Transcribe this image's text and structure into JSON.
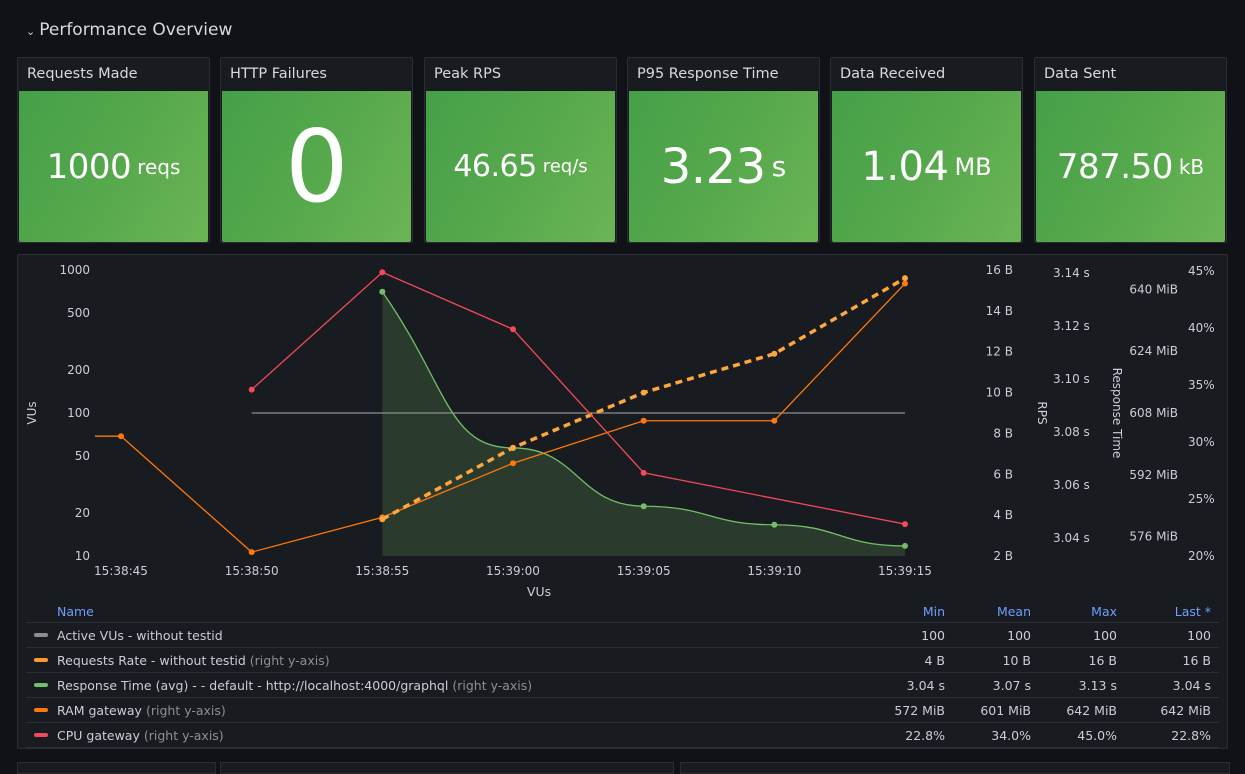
{
  "row": {
    "title": "Performance Overview",
    "collapse_icon": "chevron-down-icon"
  },
  "stats": [
    {
      "title": "Requests Made",
      "value": "1000",
      "unit": "reqs"
    },
    {
      "title": "HTTP Failures",
      "value": "0",
      "unit": ""
    },
    {
      "title": "Peak RPS",
      "value": "46.65",
      "unit": "req/s"
    },
    {
      "title": "P95 Response Time",
      "value": "3.23",
      "unit": "s"
    },
    {
      "title": "Data Received",
      "value": "1.04",
      "unit": "MB"
    },
    {
      "title": "Data Sent",
      "value": "787.50",
      "unit": "kB"
    }
  ],
  "colors": {
    "stat_green": "#56a84c",
    "vus": "#8e8e8e",
    "rps": "#ff9830",
    "resp": "#73bf69",
    "ram": "#ff780a",
    "cpu": "#f2495c"
  },
  "chart_data": {
    "type": "line",
    "title": "",
    "xlabel": "VUs",
    "x": [
      "15:38:45",
      "15:38:50",
      "15:38:55",
      "15:39:00",
      "15:39:05",
      "15:39:10",
      "15:39:15"
    ],
    "axes": {
      "left": {
        "label": "VUs",
        "scale": "log",
        "range": [
          10,
          1000
        ],
        "ticks": [
          "1000",
          "500",
          "200",
          "100",
          "50",
          "20",
          "10"
        ],
        "tick_values": [
          1000,
          500,
          200,
          100,
          50,
          20,
          10
        ]
      },
      "rps": {
        "label": "RPS",
        "range": [
          2,
          16
        ],
        "ticks": [
          "16 B",
          "14 B",
          "12 B",
          "10 B",
          "8 B",
          "6 B",
          "4 B",
          "2 B"
        ],
        "tick_values": [
          16,
          14,
          12,
          10,
          8,
          6,
          4,
          2
        ]
      },
      "resp": {
        "label": "Response Time",
        "range": [
          3.0332,
          3.1412
        ],
        "ticks": [
          "3.14 s",
          "3.12 s",
          "3.10 s",
          "3.08 s",
          "3.06 s",
          "3.04 s"
        ],
        "tick_values": [
          3.14,
          3.12,
          3.1,
          3.08,
          3.06,
          3.04
        ]
      },
      "ram": {
        "label": "",
        "range": [
          571,
          645
        ],
        "ticks": [
          "640 MiB",
          "624 MiB",
          "608 MiB",
          "592 MiB",
          "576 MiB"
        ],
        "tick_values": [
          640,
          624,
          608,
          592,
          576
        ]
      },
      "cpu": {
        "label": "",
        "range": [
          20,
          45.1
        ],
        "ticks": [
          "45%",
          "40%",
          "35%",
          "30%",
          "25%",
          "20%"
        ],
        "tick_values": [
          45,
          40,
          35,
          30,
          25,
          20
        ]
      }
    },
    "series": [
      {
        "name": "Active VUs - without testid",
        "axis": "left",
        "style": "solid",
        "values": [
          null,
          100,
          100,
          100,
          100,
          100,
          100
        ],
        "points": false
      },
      {
        "name": "Requests Rate - without testid",
        "axis": "rps",
        "style": "dashed",
        "values": [
          null,
          null,
          3.8,
          7.3,
          10.0,
          11.9,
          15.6
        ],
        "points": true
      },
      {
        "name": "Response Time (avg) - - default - http://localhost:4000/graphql",
        "axis": "resp",
        "style": "fill",
        "values": [
          null,
          null,
          3.133,
          3.074,
          3.052,
          3.045,
          3.037
        ],
        "points": true
      },
      {
        "name": "RAM gateway",
        "axis": "ram",
        "style": "solid",
        "values": [
          602,
          572,
          581,
          595,
          606,
          606,
          641.5
        ],
        "points": true
      },
      {
        "name": "CPU gateway",
        "axis": "cpu",
        "style": "solid",
        "values": [
          null,
          34.6,
          44.9,
          39.9,
          27.3,
          null,
          22.8
        ],
        "points": true
      }
    ]
  },
  "legend": {
    "headers": {
      "name": "Name",
      "min": "Min",
      "mean": "Mean",
      "max": "Max",
      "last": "Last *"
    },
    "rows": [
      {
        "name": "Active VUs - without testid",
        "hint": "",
        "color": "#8e8e8e",
        "min": "100",
        "mean": "100",
        "max": "100",
        "last": "100"
      },
      {
        "name": "Requests Rate - without testid",
        "hint": "(right y-axis)",
        "color": "#ff9830",
        "min": "4 B",
        "mean": "10 B",
        "max": "16 B",
        "last": "16 B"
      },
      {
        "name": "Response Time (avg) - - default - http://localhost:4000/graphql",
        "hint": "(right y-axis)",
        "color": "#73bf69",
        "min": "3.04 s",
        "mean": "3.07 s",
        "max": "3.13 s",
        "last": "3.04 s"
      },
      {
        "name": "RAM gateway",
        "hint": "(right y-axis)",
        "color": "#ff780a",
        "min": "572 MiB",
        "mean": "601 MiB",
        "max": "642 MiB",
        "last": "642 MiB"
      },
      {
        "name": "CPU gateway",
        "hint": "(right y-axis)",
        "color": "#f2495c",
        "min": "22.8%",
        "mean": "34.0%",
        "max": "45.0%",
        "last": "22.8%"
      }
    ]
  }
}
